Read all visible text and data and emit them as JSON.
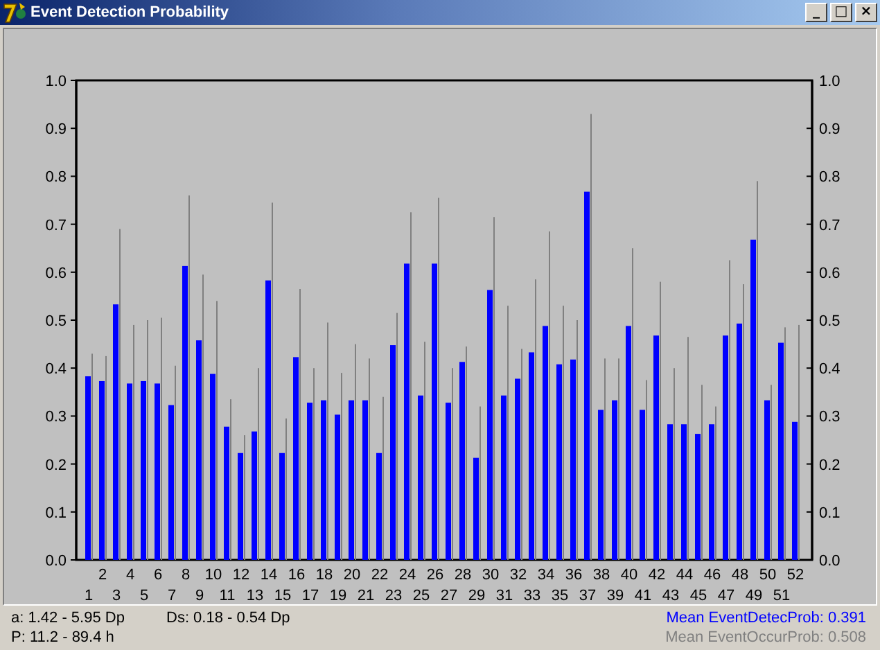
{
  "window": {
    "title": "Event Detection Probability",
    "controls": [
      "_",
      "□",
      "×"
    ]
  },
  "chart": {
    "chart_data": {
      "type": "bar",
      "categories": [
        "1",
        "2",
        "3",
        "4",
        "5",
        "6",
        "7",
        "8",
        "9",
        "10",
        "11",
        "12",
        "13",
        "14",
        "15",
        "16",
        "17",
        "18",
        "19",
        "20",
        "21",
        "22",
        "23",
        "24",
        "25",
        "26",
        "27",
        "28",
        "29",
        "30",
        "31",
        "32",
        "33",
        "34",
        "35",
        "36",
        "37",
        "38",
        "39",
        "40",
        "41",
        "42",
        "43",
        "44",
        "45",
        "46",
        "47",
        "48",
        "49",
        "50",
        "51",
        "52"
      ],
      "series": [
        {
          "color": "#0000ff",
          "values": [
            0.38,
            0.37,
            0.53,
            0.365,
            0.37,
            0.365,
            0.32,
            0.61,
            0.455,
            0.385,
            0.275,
            0.22,
            0.265,
            0.58,
            0.22,
            0.42,
            0.325,
            0.33,
            0.3,
            0.33,
            0.33,
            0.22,
            0.445,
            0.615,
            0.34,
            0.615,
            0.325,
            0.41,
            0.21,
            0.56,
            0.34,
            0.375,
            0.43,
            0.485,
            0.405,
            0.415,
            0.765,
            0.31,
            0.33,
            0.485,
            0.31,
            0.465,
            0.28,
            0.28,
            0.26,
            0.28,
            0.465,
            0.49,
            0.665,
            0.33,
            0.45,
            0.285
          ]
        },
        {
          "color": "#808080",
          "values": [
            0.43,
            0.425,
            0.69,
            0.49,
            0.5,
            0.505,
            0.405,
            0.76,
            0.595,
            0.54,
            0.335,
            0.26,
            0.4,
            0.745,
            0.295,
            0.565,
            0.4,
            0.495,
            0.39,
            0.45,
            0.42,
            0.34,
            0.515,
            0.725,
            0.455,
            0.755,
            0.4,
            0.445,
            0.32,
            0.715,
            0.53,
            0.44,
            0.585,
            0.685,
            0.53,
            0.5,
            0.93,
            0.42,
            0.42,
            0.65,
            0.375,
            0.58,
            0.4,
            0.465,
            0.365,
            0.32,
            0.625,
            0.575,
            0.79,
            0.365,
            0.485,
            0.49
          ]
        }
      ],
      "ylim": [
        0,
        1
      ],
      "yticks": [
        {
          "value": 0,
          "label": "0.0"
        },
        {
          "value": 0.1,
          "label": "0.1"
        },
        {
          "value": 0.2,
          "label": "0.2"
        },
        {
          "value": 0.3,
          "label": "0.3"
        },
        {
          "value": 0.4,
          "label": "0.4"
        },
        {
          "value": 0.5,
          "label": "0.5"
        },
        {
          "value": 0.6,
          "label": "0.6"
        },
        {
          "value": 0.7,
          "label": "0.7"
        },
        {
          "value": 0.8,
          "label": "0.8"
        },
        {
          "value": 0.9,
          "label": "0.9"
        },
        {
          "value": 1,
          "label": "1.0"
        }
      ]
    }
  },
  "status_bar": {
    "left": [
      {
        "text": "a: 1.42 - 5.95 Dp"
      },
      {
        "text": "Ds: 0.18 - 0.54 Dp"
      },
      {
        "text": "P: 11.2 - 89.4 h"
      }
    ],
    "means": [
      {
        "text": "Mean EventDetecProb: 0.391",
        "color": "#0000ff"
      },
      {
        "text": "Mean EventOccurProb: 0.508",
        "color": "#808080"
      }
    ]
  }
}
